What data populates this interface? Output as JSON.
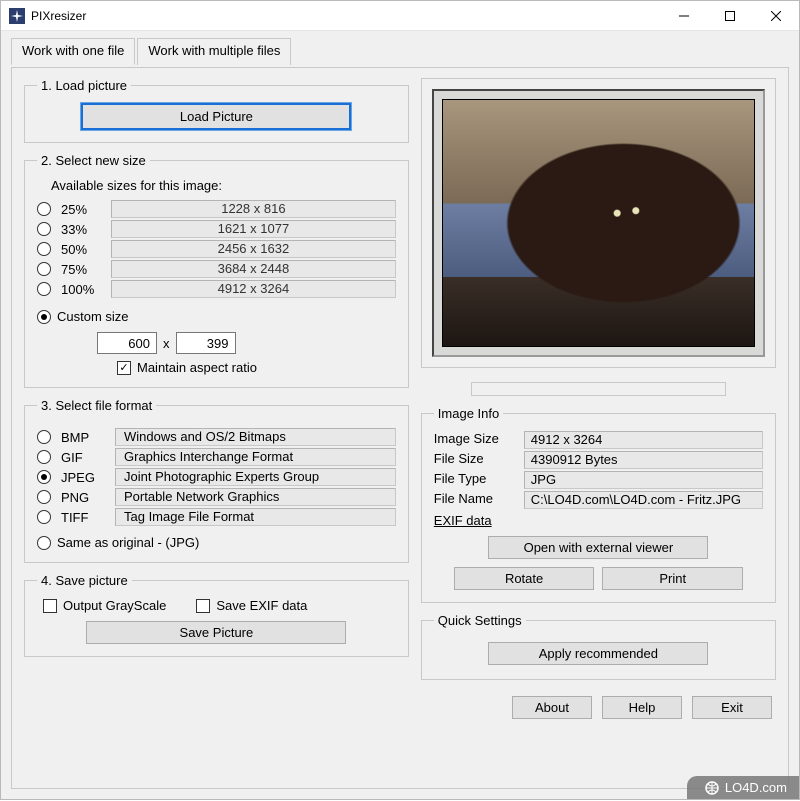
{
  "window": {
    "title": "PIXresizer"
  },
  "tabs": {
    "one": "Work with one file",
    "multi": "Work with multiple files"
  },
  "section1": {
    "legend": "1. Load picture",
    "load_btn": "Load Picture"
  },
  "section2": {
    "legend": "2. Select new size",
    "available_label": "Available sizes for this image:",
    "sizes": [
      {
        "pct": "25%",
        "dim": "1228  x  816"
      },
      {
        "pct": "33%",
        "dim": "1621  x  1077"
      },
      {
        "pct": "50%",
        "dim": "2456  x  1632"
      },
      {
        "pct": "75%",
        "dim": "3684  x  2448"
      },
      {
        "pct": "100%",
        "dim": "4912  x  3264"
      }
    ],
    "custom_label": "Custom size",
    "custom_w": "600",
    "custom_x": "x",
    "custom_h": "399",
    "maintain_label": "Maintain aspect ratio"
  },
  "section3": {
    "legend": "3. Select file format",
    "formats": [
      {
        "code": "BMP",
        "desc": "Windows and OS/2 Bitmaps"
      },
      {
        "code": "GIF",
        "desc": "Graphics Interchange Format"
      },
      {
        "code": "JPEG",
        "desc": "Joint Photographic Experts Group"
      },
      {
        "code": "PNG",
        "desc": "Portable Network Graphics"
      },
      {
        "code": "TIFF",
        "desc": "Tag Image File Format"
      }
    ],
    "same_label": "Same as original  - (JPG)"
  },
  "section4": {
    "legend": "4. Save picture",
    "grayscale_label": "Output GrayScale",
    "exif_label": "Save EXIF data",
    "save_btn": "Save Picture"
  },
  "info": {
    "legend": "Image Info",
    "labels": {
      "size": "Image Size",
      "filesize": "File Size",
      "type": "File Type",
      "name": "File Name"
    },
    "values": {
      "size": "4912 x 3264",
      "filesize": "4390912 Bytes",
      "type": "JPG",
      "name": "C:\\LO4D.com\\LO4D.com - Fritz.JPG"
    },
    "exif_link": "EXIF data",
    "open_btn": "Open with external viewer",
    "rotate_btn": "Rotate",
    "print_btn": "Print"
  },
  "quick": {
    "legend": "Quick Settings",
    "apply_btn": "Apply recommended"
  },
  "footer": {
    "about": "About",
    "help": "Help",
    "exit": "Exit"
  },
  "watermark": "LO4D.com"
}
